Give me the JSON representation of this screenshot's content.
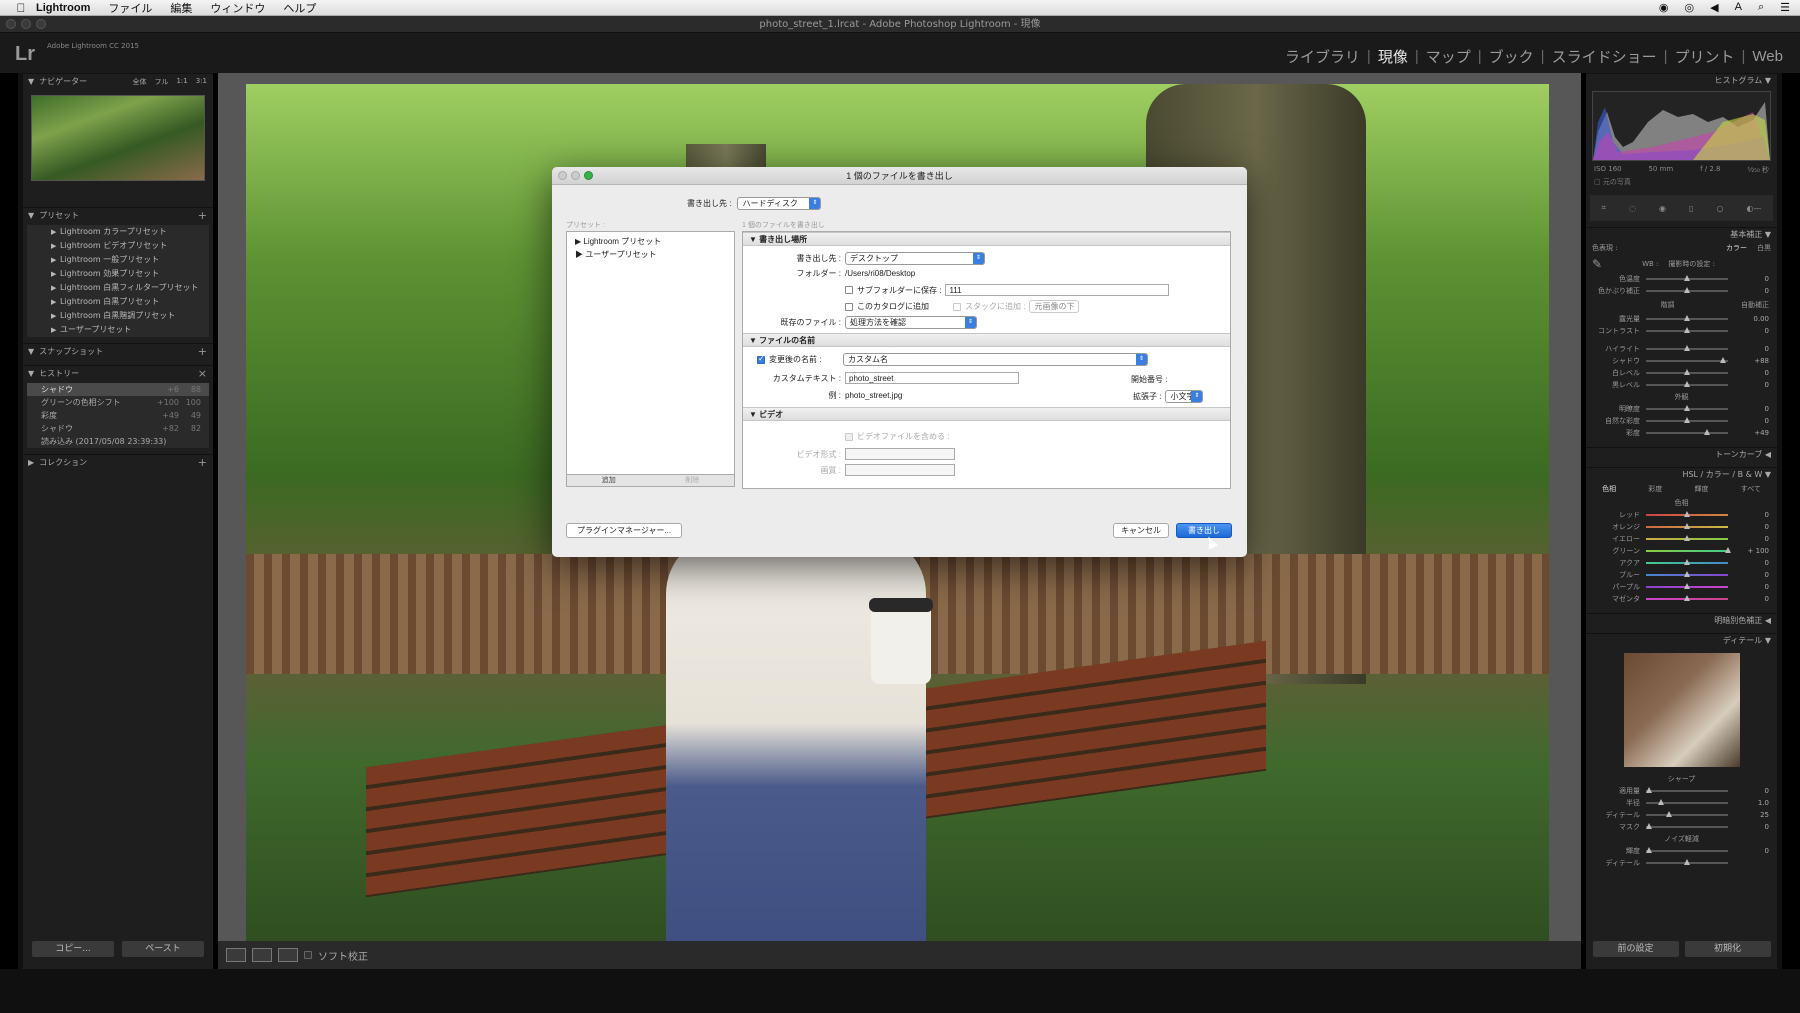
{
  "menubar": {
    "app": "Lightroom",
    "items": [
      "ファイル",
      "編集",
      "ウィンドウ",
      "ヘルプ"
    ]
  },
  "window": {
    "title": "photo_street_1.lrcat - Adobe Photoshop Lightroom - 現像"
  },
  "identity": {
    "logo": "Lr",
    "version": "Adobe Lightroom CC 2015"
  },
  "modules": [
    "ライブラリ",
    "現像",
    "マップ",
    "ブック",
    "スライドショー",
    "プリント",
    "Web"
  ],
  "left_panel": {
    "navigator": {
      "title": "ナビゲーター",
      "zoom": [
        "全体",
        "フル",
        "1:1",
        "3:1"
      ]
    },
    "presets": {
      "title": "プリセット",
      "items": [
        "Lightroom カラープリセット",
        "Lightroom ビデオプリセット",
        "Lightroom 一般プリセット",
        "Lightroom 効果プリセット",
        "Lightroom 白黒フィルタープリセット",
        "Lightroom 白黒プリセット",
        "Lightroom 白黒階調プリセット",
        "ユーザープリセット"
      ]
    },
    "snapshots": {
      "title": "スナップショット"
    },
    "history": {
      "title": "ヒストリー",
      "items": [
        {
          "label": "シャドウ",
          "a": "+6",
          "b": "88"
        },
        {
          "label": "グリーンの色相シフト",
          "a": "+100",
          "b": "100"
        },
        {
          "label": "彩度",
          "a": "+49",
          "b": "49"
        },
        {
          "label": "シャドウ",
          "a": "+82",
          "b": "82"
        },
        {
          "label": "読み込み (2017/05/08 23:39:33)",
          "a": "",
          "b": ""
        }
      ]
    },
    "collections": {
      "title": "コレクション"
    },
    "copy_button": "コピー...",
    "paste_button": "ペースト"
  },
  "toolbar": {
    "softproof": "ソフト校正"
  },
  "right_panel": {
    "histogram": {
      "title": "ヒストグラム",
      "iso": "ISO 160",
      "focal": "50 mm",
      "fstop": "f / 2.8",
      "shutter": "¹⁄₂₅₀ 秒",
      "original": "元の写真"
    },
    "basic": {
      "title": "基本補正",
      "treatment_label": "色表現 :",
      "treatment_color": "カラー",
      "treatment_bw": "白黒",
      "wb_label": "WB :",
      "wb_value": "撮影時の設定 :",
      "temp": "色温度",
      "tint": "色かぶり補正",
      "tone": "階調",
      "auto": "自動補正",
      "sliders": [
        {
          "label": "露光量",
          "value": "0.00"
        },
        {
          "label": "コントラスト",
          "value": "0"
        },
        {
          "label": "ハイライト",
          "value": "0"
        },
        {
          "label": "シャドウ",
          "value": "+88"
        },
        {
          "label": "白レベル",
          "value": "0"
        },
        {
          "label": "黒レベル",
          "value": "0"
        }
      ],
      "presence": "外観",
      "presence_sliders": [
        {
          "label": "明瞭度",
          "value": "0"
        },
        {
          "label": "自然な彩度",
          "value": "0"
        },
        {
          "label": "彩度",
          "value": "+49"
        }
      ],
      "temp_value": "0",
      "tint_value": "0"
    },
    "tone_curve": "トーンカーブ",
    "hsl": {
      "title": "HSL / カラー / B & W",
      "tabs": [
        "色相",
        "彩度",
        "輝度",
        "すべて"
      ],
      "section": "色相",
      "sliders": [
        {
          "label": "レッド",
          "value": "0"
        },
        {
          "label": "オレンジ",
          "value": "0"
        },
        {
          "label": "イエロー",
          "value": "0"
        },
        {
          "label": "グリーン",
          "value": "+ 100"
        },
        {
          "label": "アクア",
          "value": "0"
        },
        {
          "label": "ブルー",
          "value": "0"
        },
        {
          "label": "パープル",
          "value": "0"
        },
        {
          "label": "マゼンタ",
          "value": "0"
        }
      ]
    },
    "split_toning": "明暗別色補正",
    "detail": {
      "title": "ディテール",
      "sharpen": "シャープ",
      "sharpen_sliders": [
        {
          "label": "適用量",
          "value": "0"
        },
        {
          "label": "半径",
          "value": "1.0"
        },
        {
          "label": "ディテール",
          "value": "25"
        },
        {
          "label": "マスク",
          "value": "0"
        }
      ],
      "noise": "ノイズ軽減",
      "noise_sliders": [
        {
          "label": "輝度",
          "value": "0"
        },
        {
          "label": "ディテール",
          "value": ""
        }
      ]
    },
    "prev_button": "前の設定",
    "reset_button": "初期化"
  },
  "dialog": {
    "title": "1 個のファイルを書き出し",
    "export_to_label": "書き出し先 :",
    "export_to_value": "ハードディスク",
    "preset_label": "プリセット :",
    "count_label": "1 個のファイルを書き出し",
    "presets": [
      "Lightroom プリセット",
      "ユーザープリセット"
    ],
    "add_button": "追加",
    "remove_button": "削除",
    "location": {
      "title": "書き出し場所",
      "export_to_label": "書き出し先 :",
      "export_to_value": "デスクトップ",
      "folder_label": "フォルダー :",
      "folder_value": "/Users/ri08/Desktop",
      "subfolder_label": "サブフォルダーに保存 :",
      "subfolder_value": "111",
      "catalog_label": "このカタログに追加",
      "stack_label": "スタックに追加 :",
      "stack_value": "元画像の下",
      "existing_label": "既存のファイル :",
      "existing_value": "処理方法を確認"
    },
    "naming": {
      "title": "ファイルの名前",
      "rename_label": "変更後の名前 :",
      "rename_value": "カスタム名",
      "custom_label": "カスタムテキスト :",
      "custom_value": "photo_street",
      "start_label": "開始番号 :",
      "example_label": "例 :",
      "example_value": "photo_street.jpg",
      "ext_label": "拡張子 :",
      "ext_value": "小文字"
    },
    "video": {
      "title": "ビデオ",
      "include_label": "ビデオファイルを含める :",
      "format_label": "ビデオ形式 :",
      "quality_label": "画質 :"
    },
    "plugin_button": "プラグインマネージャー...",
    "cancel_button": "キャンセル",
    "export_button": "書き出し"
  }
}
